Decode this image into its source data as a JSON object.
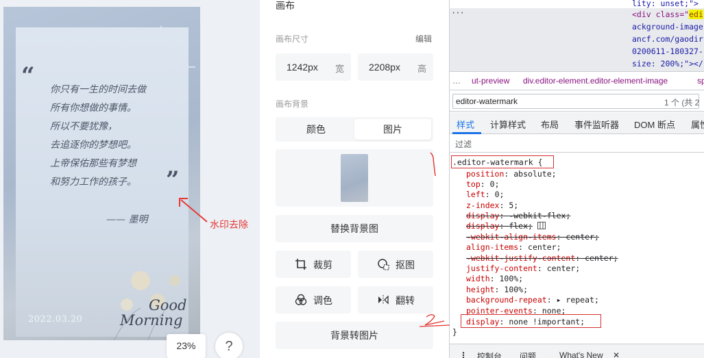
{
  "canvas": {
    "poem_lines": [
      "你只有一生的时间去做",
      "所有你想做的事情。",
      "所以不要犹豫，",
      "去追逐你的梦想吧。",
      "上帝保佑那些有梦想",
      "和努力工作的孩子。"
    ],
    "author": "—— 墨明",
    "date": "2022.03.20",
    "greeting_line1": "Good",
    "greeting_line2": "Morning",
    "annotation": "水印去除",
    "zoom": "23%",
    "help": "?"
  },
  "props": {
    "title": "画布",
    "size_label": "画布尺寸",
    "edit_label": "编辑",
    "width_value": "1242px",
    "width_unit": "宽",
    "height_value": "2208px",
    "height_unit": "高",
    "bg_label": "画布背景",
    "bg_tab_color": "颜色",
    "bg_tab_image": "图片",
    "replace_bg": "替换背景图",
    "crop": "裁剪",
    "cutout": "抠图",
    "adjust": "调色",
    "flip": "翻转",
    "bg_to_image": "背景转图片"
  },
  "devtools": {
    "dom_lines": [
      "lity: unset;\">",
      "<div class=\"",
      "ackground-image",
      "ancf.com/gaodir",
      "0200611-180327-",
      "size: 200%;\"></"
    ],
    "dom_highlight": "edi",
    "breadcrumb_1": "ut-preview",
    "breadcrumb_2": "div.editor-element.editor-element-image",
    "breadcrumb_3": "sp",
    "search_value": "editor-watermark",
    "search_count": "1 个 (共 2",
    "tabs": [
      "样式",
      "计算样式",
      "布局",
      "事件监听器",
      "DOM 断点",
      "属性"
    ],
    "filter_placeholder": "过滤",
    "css_selector": ".editor-watermark {",
    "css_props": [
      {
        "name": "position",
        "value": "absolute;"
      },
      {
        "name": "top",
        "value": "0;"
      },
      {
        "name": "left",
        "value": "0;"
      },
      {
        "name": "z-index",
        "value": "5;"
      },
      {
        "name": "display",
        "value": "-webkit-flex;"
      },
      {
        "name": "display",
        "value": "flex;"
      },
      {
        "name": "-webkit-align-items",
        "value": "center;"
      },
      {
        "name": "align-items",
        "value": "center;"
      },
      {
        "name": "-webkit-justify-content",
        "value": "center;"
      },
      {
        "name": "justify-content",
        "value": "center;"
      },
      {
        "name": "width",
        "value": "100%;"
      },
      {
        "name": "height",
        "value": "100%;"
      },
      {
        "name": "background-repeat",
        "value": "▸ repeat;"
      },
      {
        "name": "pointer-events",
        "value": "none;"
      },
      {
        "name": "display",
        "value": "none !important;"
      }
    ],
    "css_close": "}",
    "drawer_tabs": [
      "控制台",
      "问题",
      "What's New",
      "✕"
    ],
    "drawer_dots": "⋮"
  },
  "marks": {
    "one": "1",
    "two": "2"
  },
  "colors": {
    "accent": "#1a73e8",
    "annotation": "#e53935",
    "selector_box": "#d32f2f"
  }
}
